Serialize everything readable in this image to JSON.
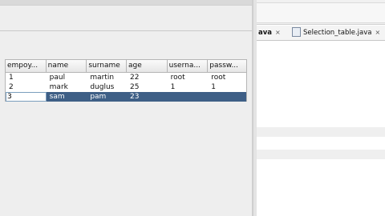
{
  "table": {
    "columns": [
      "empoy...",
      "name",
      "surname",
      "age",
      "userna...",
      "passw..."
    ],
    "rows": [
      [
        "1",
        "paul",
        "martin",
        "22",
        "root",
        "root"
      ],
      [
        "2",
        "mark",
        "duglus",
        "25",
        "1",
        "1"
      ],
      [
        "3",
        "sam",
        "pam",
        "23",
        "",
        ""
      ]
    ],
    "selected_row": 2
  },
  "editor": {
    "tabs": [
      {
        "label": "ava",
        "close": "×"
      },
      {
        "label": "Selection_table.java",
        "close": "×"
      }
    ]
  },
  "colors": {
    "selection": "#3e5f86",
    "header_bg": "#eeeeee"
  }
}
